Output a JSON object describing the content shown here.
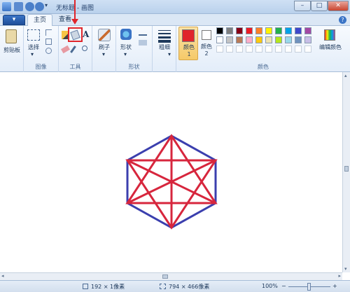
{
  "window": {
    "title": "无标题 - 画图",
    "minimize": "–",
    "maximize": "□",
    "close": "✕"
  },
  "tabs": {
    "app_menu": "▾",
    "home": "主页",
    "view": "查看"
  },
  "ribbon": {
    "clipboard": {
      "label": "剪贴板"
    },
    "image": {
      "select_label": "选择",
      "group_label": "图像"
    },
    "tools": {
      "group_label": "工具",
      "text_tool": "A"
    },
    "brushes": {
      "label": "刷子"
    },
    "shapes": {
      "label": "形状",
      "group_label": "形状"
    },
    "size": {
      "label": "粗细"
    },
    "color1": {
      "label": "颜色 1",
      "value": "#e0252b"
    },
    "color2": {
      "label": "颜色 2",
      "value": "#ffffff"
    },
    "edit_colors": {
      "label": "编辑颜色"
    },
    "colors_group_label": "颜色",
    "palette_row1": [
      "#000000",
      "#7f7f7f",
      "#880015",
      "#ed1c24",
      "#ff7f27",
      "#fff200",
      "#22b14c",
      "#00a2e8",
      "#3f48cc",
      "#a349a4"
    ],
    "palette_row2": [
      "#ffffff",
      "#c3c3c3",
      "#b97a57",
      "#ffaec9",
      "#ffc90e",
      "#efe4b0",
      "#b5e61d",
      "#99d9ea",
      "#7092be",
      "#c8bfe7"
    ]
  },
  "drawing": {
    "outline_color": "#3b3fae",
    "star_color": "#d7263d"
  },
  "status": {
    "cursor_pos": "192 × 1像素",
    "canvas_size": "794 × 466像素",
    "zoom": "100%",
    "zoom_minus": "−",
    "zoom_plus": "+"
  }
}
